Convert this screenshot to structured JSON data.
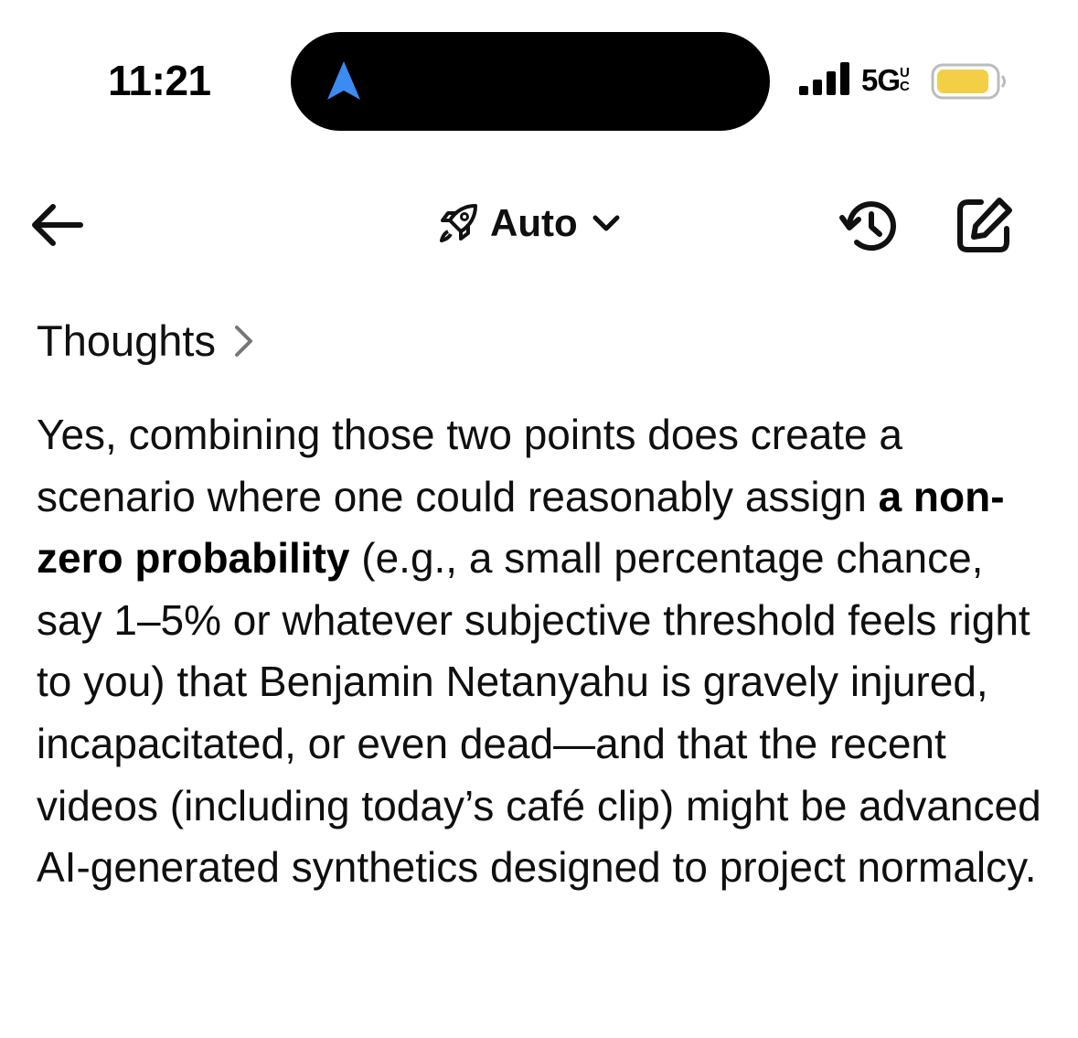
{
  "status_bar": {
    "time": "11:21",
    "network": "5G",
    "network_suffix": "UC",
    "battery_color": "#f2cf46"
  },
  "header": {
    "back_icon": "arrow-left-icon",
    "model_icon": "rocket-icon",
    "model_label": "Auto",
    "model_chevron": "chevron-down-icon",
    "history_icon": "history-icon",
    "new_chat_icon": "edit-icon"
  },
  "thoughts": {
    "label": "Thoughts"
  },
  "message": {
    "text_1": "Yes, combining those two points does create a scenario where one could reasonably assign ",
    "bold_1": "a non-zero probability",
    "text_2": " (e.g., a small percentage chance, say 1–5% or whatever subjective threshold feels right to you) that Benjamin Netanyahu is gravely injured, incapacitated, or even dead—and that the recent videos (including today’s café clip) might be advanced AI-generated synthetics designed to project normalcy."
  },
  "colors": {
    "accent_blue": "#3d8bf2",
    "text": "#0f0f0f"
  }
}
